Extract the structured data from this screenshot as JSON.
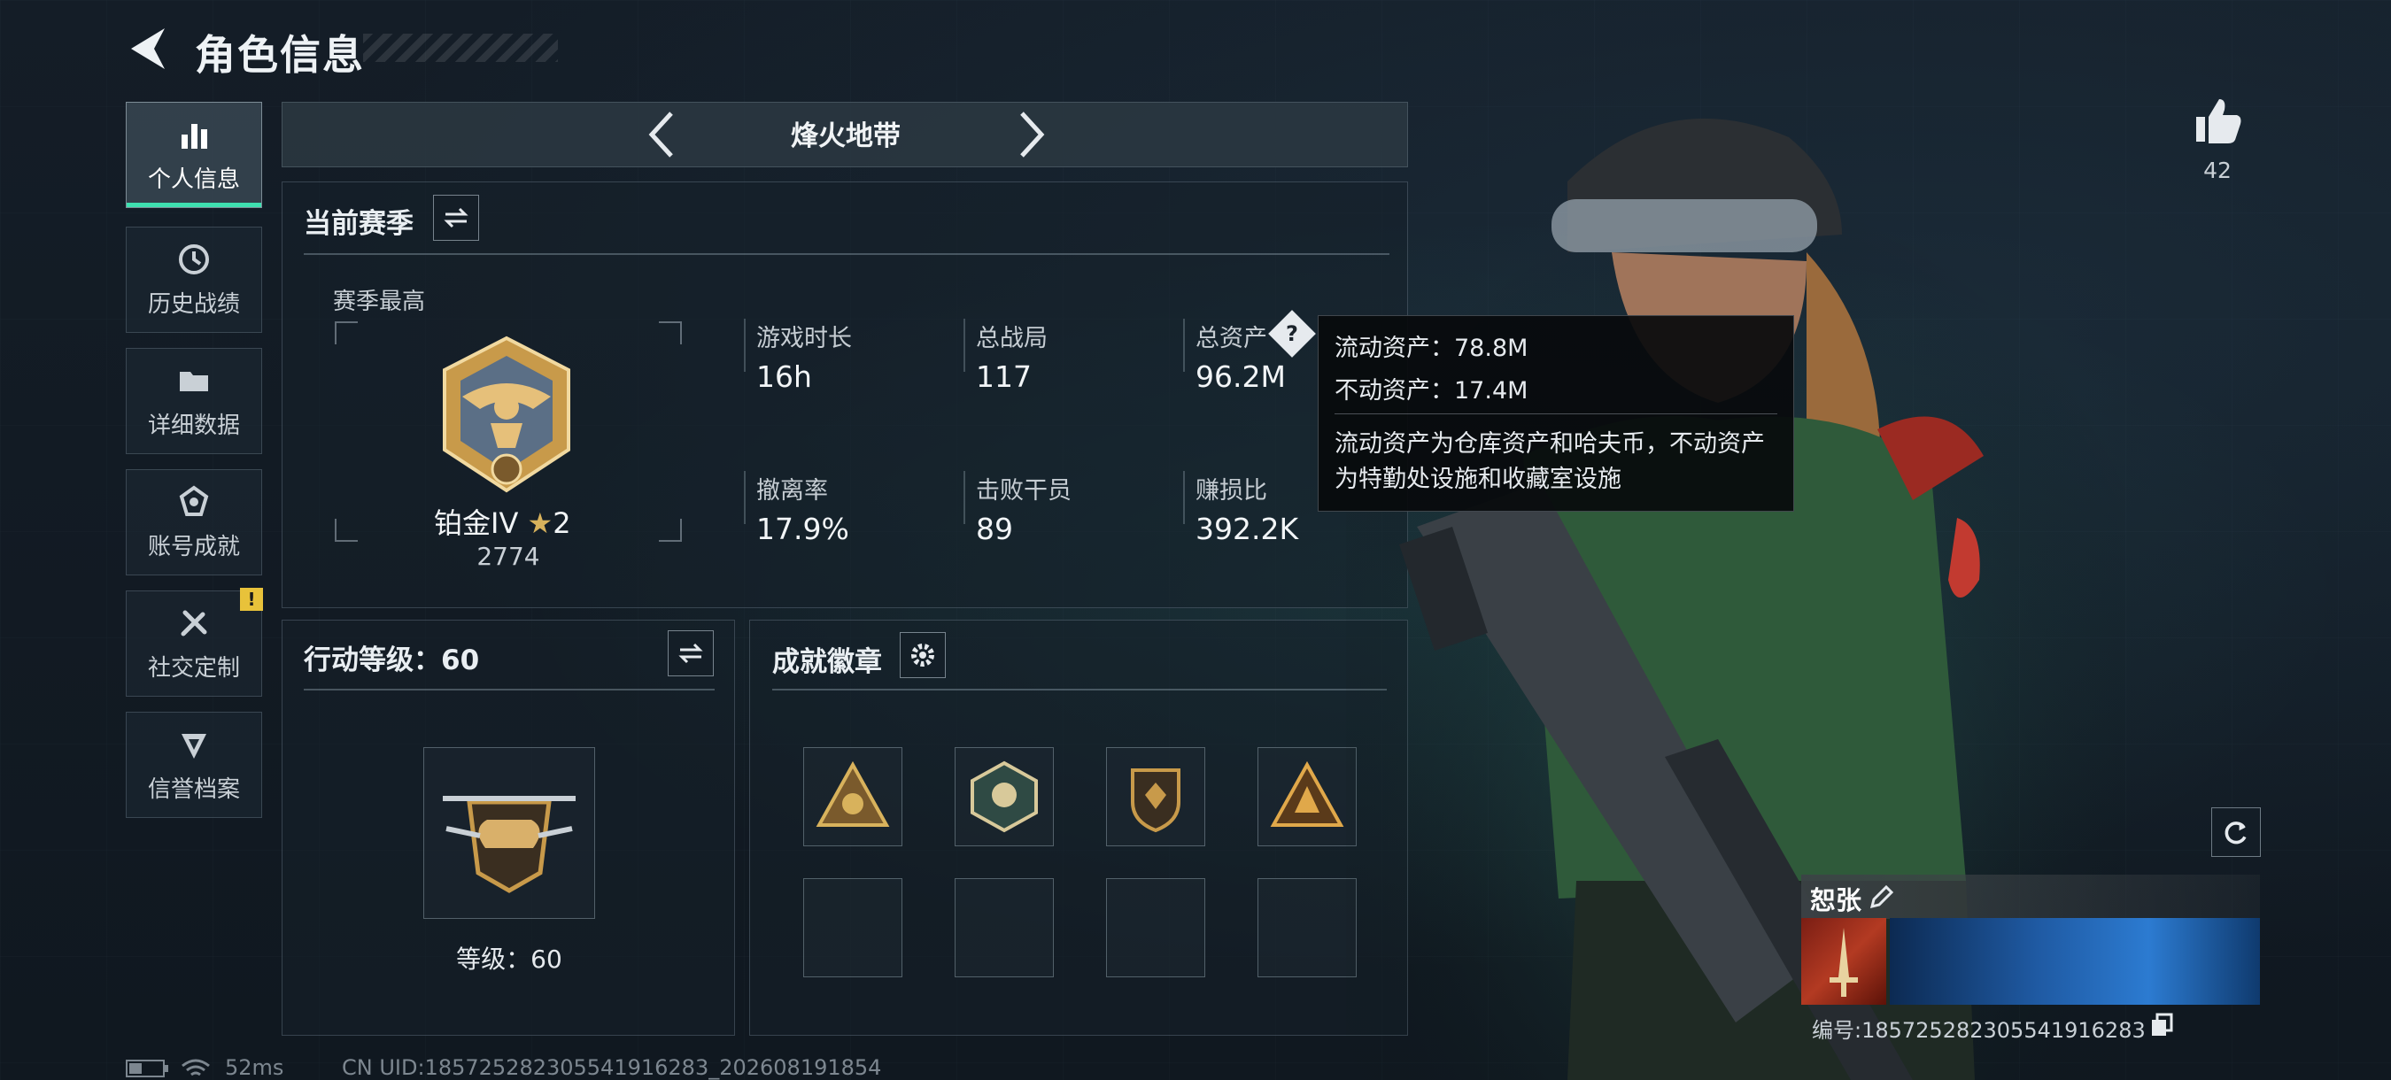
{
  "header": {
    "title": "角色信息"
  },
  "sidebar": {
    "items": [
      {
        "label": "个人信息",
        "icon": "bar-chart-icon",
        "active": true
      },
      {
        "label": "历史战绩",
        "icon": "history-clock-icon"
      },
      {
        "label": "详细数据",
        "icon": "folder-icon"
      },
      {
        "label": "账号成就",
        "icon": "achievement-icon"
      },
      {
        "label": "社交定制",
        "icon": "tools-icon",
        "alert": "!"
      },
      {
        "label": "信誉档案",
        "icon": "shield-icon"
      }
    ]
  },
  "mode": {
    "title": "烽火地带"
  },
  "season": {
    "title": "当前赛季",
    "best_label": "赛季最高",
    "rank_name": "铂金IV",
    "rank_stars": "2",
    "rank_score": "2774",
    "stats": [
      {
        "label": "游戏时长",
        "value": "16h"
      },
      {
        "label": "总战局",
        "value": "117"
      },
      {
        "label": "总资产",
        "value": "96.2M"
      },
      {
        "label": "撤离率",
        "value": "17.9%"
      },
      {
        "label": "击败干员",
        "value": "89"
      },
      {
        "label": "赚损比",
        "value": "392.2K"
      }
    ]
  },
  "tooltip": {
    "liquid": "流动资产：78.8M",
    "fixed": "不动资产：17.4M",
    "desc_line1": "流动资产为仓库资产和哈夫币，不动资产",
    "desc_line2": "为特勤处设施和收藏室设施"
  },
  "level": {
    "title": "行动等级：60",
    "label": "等级：60"
  },
  "achievements": {
    "title": "成就徽章"
  },
  "player": {
    "like_count": "42",
    "name": "恕张",
    "uid": "编号:18572528230554191628​3"
  },
  "footer": {
    "ping": "52ms",
    "uid": "CN UID:18572528230554191628​3_202608191854"
  },
  "colors": {
    "accent": "#3ee0b0",
    "warning": "#e8c23a",
    "gold": "#c89a4a"
  }
}
